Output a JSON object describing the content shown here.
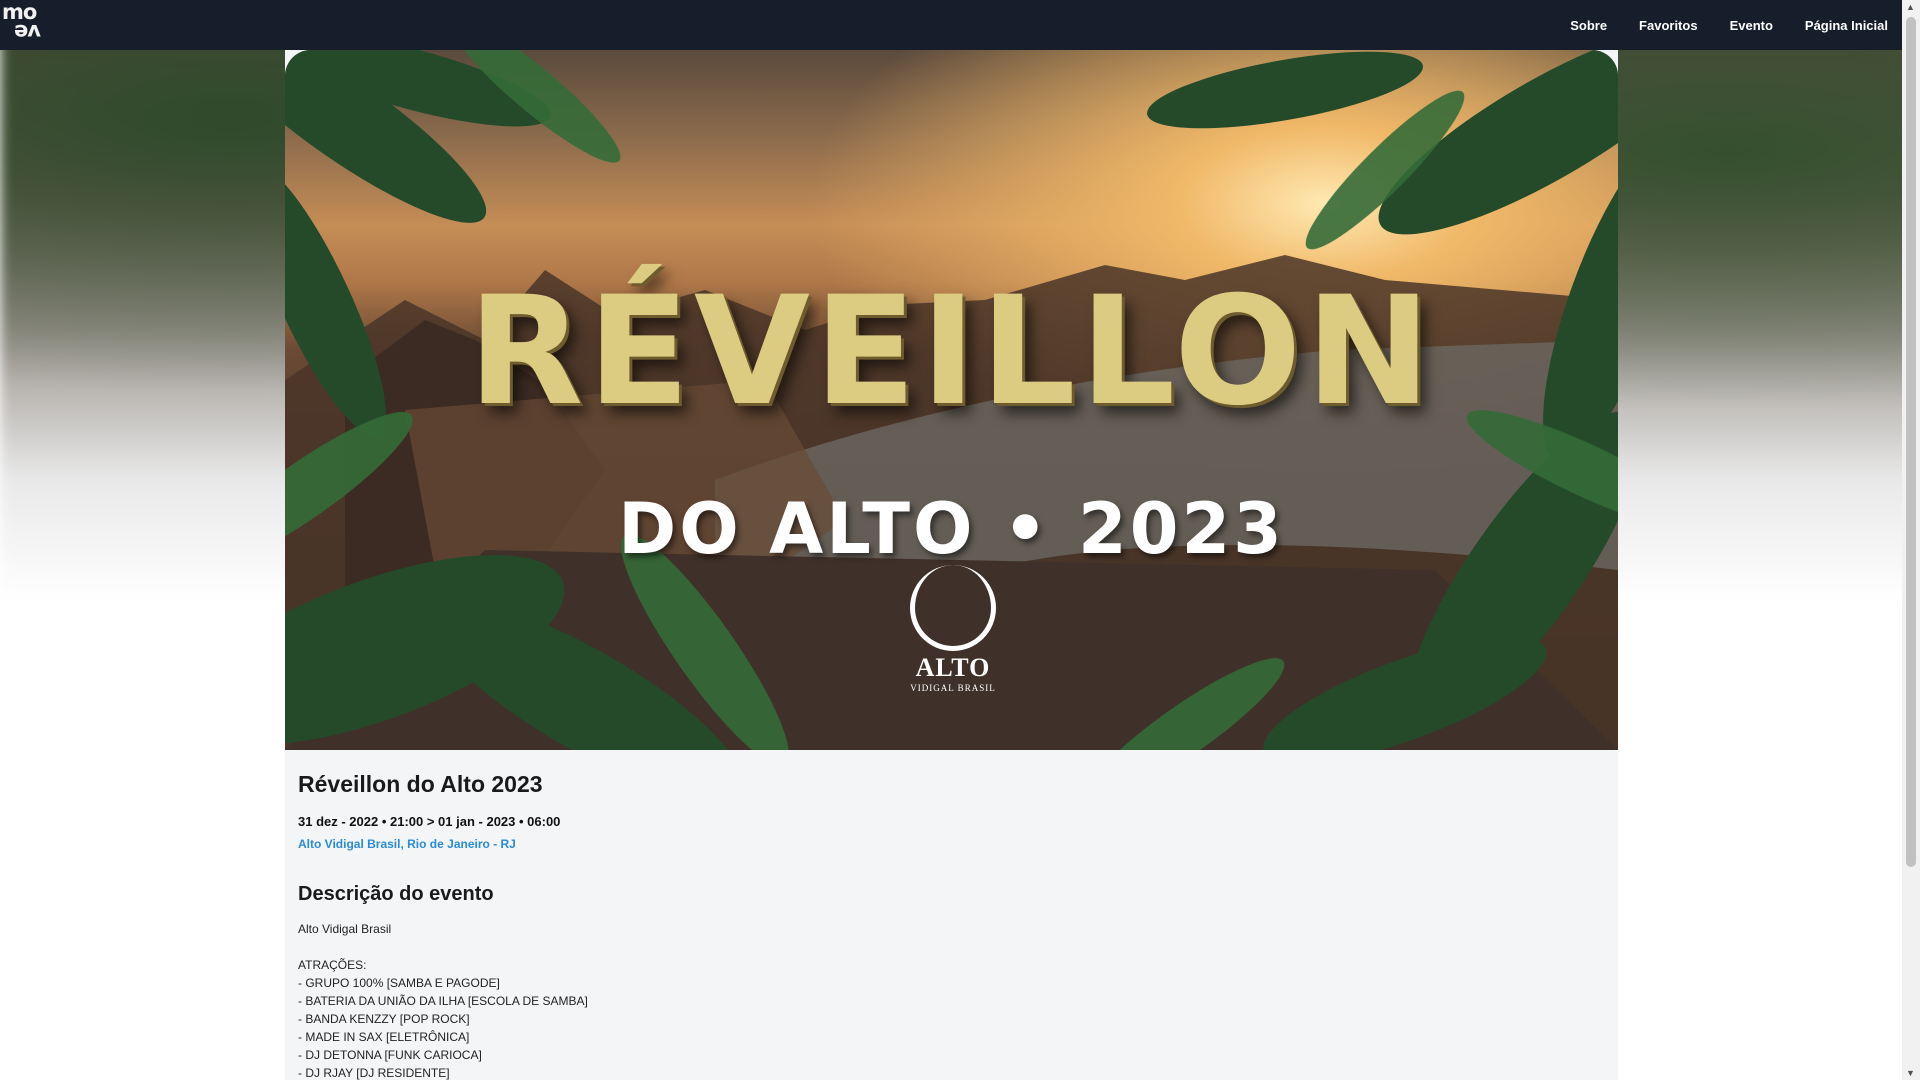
{
  "nav": {
    "logo_top": "mo",
    "logo_bottom": "ve",
    "items": [
      {
        "label": "Sobre"
      },
      {
        "label": "Favoritos"
      },
      {
        "label": "Evento"
      },
      {
        "label": "Página Inicial"
      }
    ]
  },
  "banner": {
    "headline": "RÉVEILLON",
    "subline": "DO ALTO • 2023",
    "brand_name": "ALTO",
    "brand_tag": "VIDIGAL BRASIL"
  },
  "event": {
    "title": "Réveillon do Alto 2023",
    "date": "31 dez - 2022 • 21:00 > 01 jan - 2023 • 06:00",
    "location": "Alto Vidigal Brasil, Rio de Janeiro - RJ",
    "accent_color": "#2a8bd6"
  },
  "description": {
    "heading": "Descrição do evento",
    "organizer": "Alto Vidigal Brasil",
    "attractions_heading": "ATRAÇÕES:",
    "attractions": [
      "- GRUPO 100% [SAMBA E PAGODE]",
      "- BATERIA DA UNIÃO DA ILHA [ESCOLA DE SAMBA]",
      "- BANDA KENZZY [POP ROCK]",
      "- MADE IN SAX [ELETRÔNICA]",
      "- DJ DETONNA [FUNK CARIOCA]",
      "- DJ RJAY [DJ RESIDENTE]"
    ]
  }
}
